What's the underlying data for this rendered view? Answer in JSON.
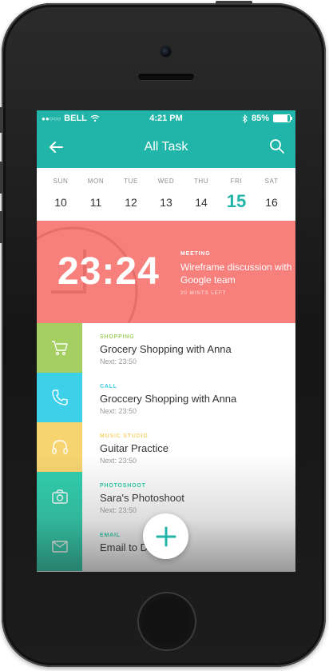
{
  "status_bar": {
    "carrier": "BELL",
    "time": "4:21 PM",
    "battery": "85%",
    "battery_level": 0.85
  },
  "app_bar": {
    "title": "All Task",
    "left_icon": "back-arrow-icon",
    "right_icon": "search-icon"
  },
  "week": {
    "days": [
      {
        "name": "SUN",
        "date": "10"
      },
      {
        "name": "MON",
        "date": "11"
      },
      {
        "name": "TUE",
        "date": "12"
      },
      {
        "name": "WED",
        "date": "13"
      },
      {
        "name": "THU",
        "date": "14"
      },
      {
        "name": "FRI",
        "date": "15"
      },
      {
        "name": "SAT",
        "date": "16"
      }
    ],
    "selected": "FRI"
  },
  "current_task": {
    "time": "23:24",
    "category": "MEETING",
    "title": "Wireframe discussion with Google team",
    "remaining": "20 MINTS LEFT",
    "color": "#f7807c"
  },
  "tasks": [
    {
      "category": "SHOPPING",
      "title": "Grocery Shopping with Anna",
      "next": "Next: 23:50",
      "color": "#a5cf63",
      "icon": "cart-icon"
    },
    {
      "category": "CALL",
      "title": "Groccery Shopping with Anna",
      "next": "Next: 23:50",
      "color": "#3ecfe9",
      "icon": "phone-icon"
    },
    {
      "category": "MUSIC STUDIO",
      "title": "Guitar Practice",
      "next": "Next: 23:50",
      "color": "#f6d470",
      "icon": "headphones-icon"
    },
    {
      "category": "PHOTOSHOOT",
      "title": "Sara's Photoshoot",
      "next": "Next: 23:50",
      "color": "#2ed0ae",
      "icon": "camera-icon"
    },
    {
      "category": "EMAIL",
      "title": "Email to D",
      "next": "",
      "color": "#2ed0ae",
      "icon": "mail-icon"
    }
  ],
  "fab": {
    "icon": "plus-icon",
    "color": "#20b5a8"
  },
  "colors": {
    "accent": "#20b5a8"
  }
}
